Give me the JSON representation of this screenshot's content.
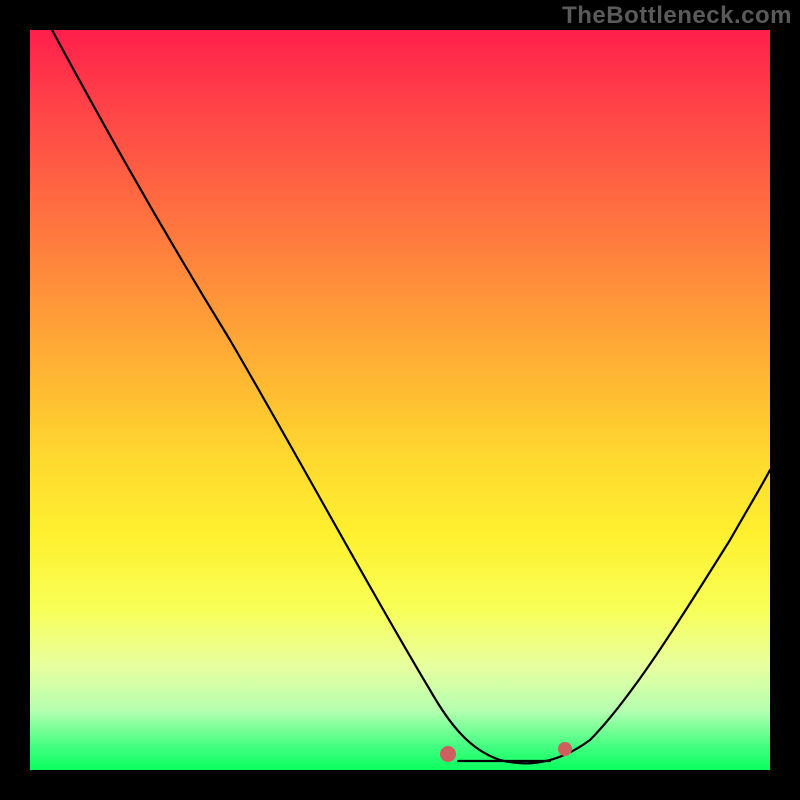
{
  "watermark": "TheBottleneck.com",
  "chart_data": {
    "type": "line",
    "title": "",
    "xlabel": "",
    "ylabel": "",
    "xlim": [
      0,
      100
    ],
    "ylim": [
      0,
      100
    ],
    "grid": false,
    "legend": false,
    "series": [
      {
        "name": "curve",
        "x": [
          3,
          10,
          20,
          30,
          40,
          50,
          56,
          60,
          64,
          68,
          72,
          78,
          84,
          90,
          100
        ],
        "y": [
          100,
          88,
          72,
          56,
          40,
          24,
          12,
          6,
          2,
          1,
          2,
          6,
          14,
          24,
          44
        ]
      }
    ],
    "markers": {
      "start": {
        "x": 56,
        "y": 4
      },
      "end": {
        "x": 72,
        "y": 4
      },
      "run": {
        "x1": 58,
        "y1": 1.2,
        "x2": 70,
        "y2": 1.2
      }
    },
    "background_gradient": {
      "top": "#ff1f4b",
      "upper_mid": "#ffba32",
      "lower_mid": "#fff02f",
      "bottom": "#0aff5f"
    }
  }
}
